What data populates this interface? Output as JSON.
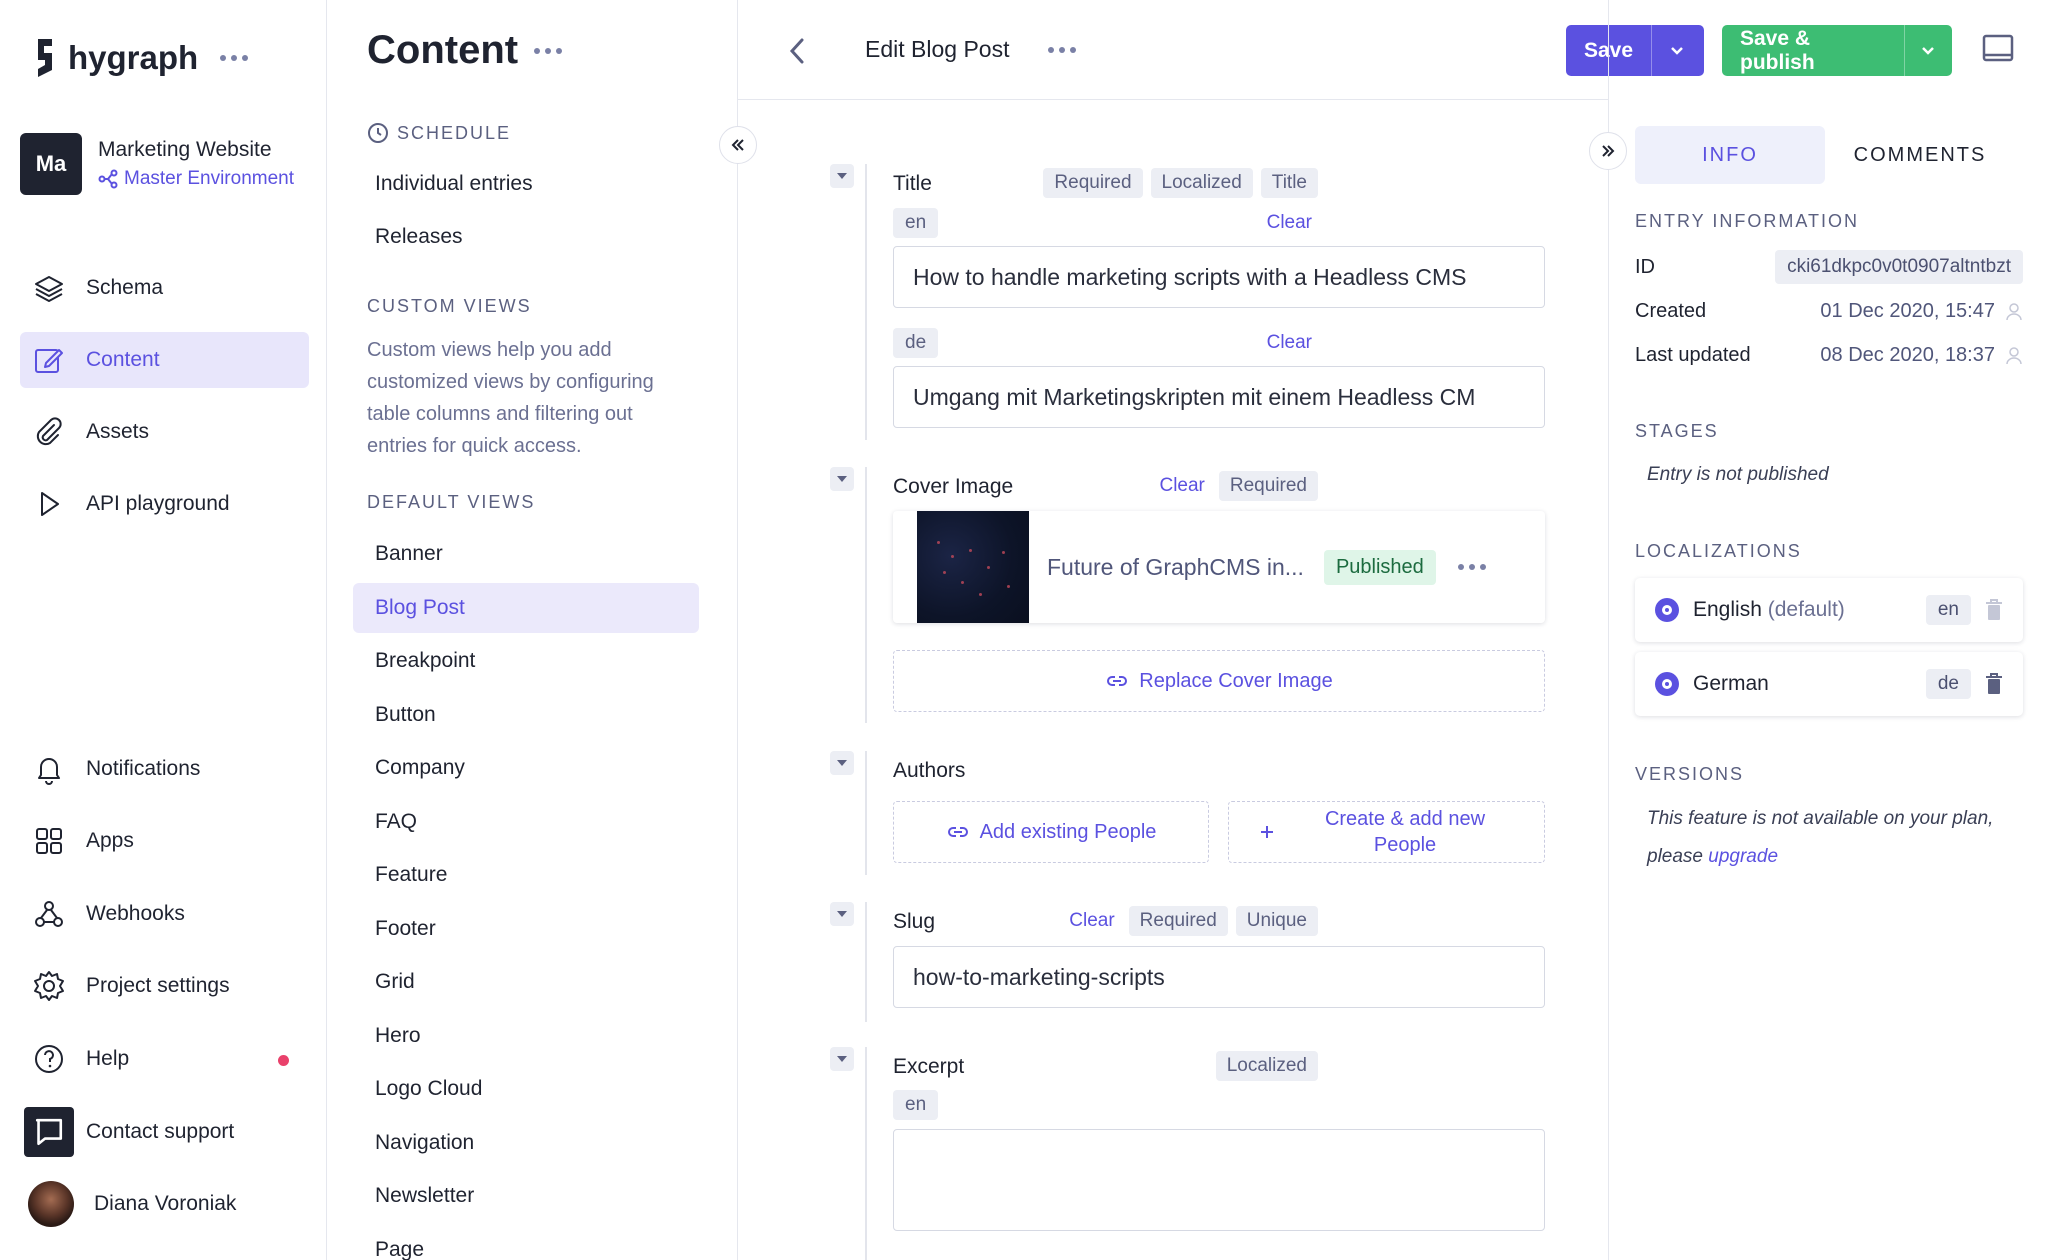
{
  "brand": {
    "name": "hygraph"
  },
  "project": {
    "initials": "Ma",
    "name": "Marketing Website",
    "environment": "Master Environment"
  },
  "nav": {
    "top": [
      {
        "label": "Schema",
        "icon": "layers-icon"
      },
      {
        "label": "Content",
        "icon": "edit-icon",
        "active": true
      },
      {
        "label": "Assets",
        "icon": "paperclip-icon"
      },
      {
        "label": "API playground",
        "icon": "play-icon"
      }
    ],
    "bottom": [
      {
        "label": "Notifications",
        "icon": "bell-icon"
      },
      {
        "label": "Apps",
        "icon": "apps-icon"
      },
      {
        "label": "Webhooks",
        "icon": "webhook-icon"
      },
      {
        "label": "Project settings",
        "icon": "gear-icon"
      },
      {
        "label": "Help",
        "icon": "help-icon"
      },
      {
        "label": "Contact support",
        "icon": "chat-icon"
      }
    ],
    "user": "Diana Voroniak"
  },
  "views": {
    "title": "Content",
    "schedule_heading": "SCHEDULE",
    "schedule_items": [
      "Individual entries",
      "Releases"
    ],
    "custom_heading": "CUSTOM VIEWS",
    "custom_desc": "Custom views help you add customized views by configuring table columns and filtering out entries for quick access.",
    "default_heading": "DEFAULT VIEWS",
    "default_items": [
      "Banner",
      "Blog Post",
      "Breakpoint",
      "Button",
      "Company",
      "FAQ",
      "Feature",
      "Footer",
      "Grid",
      "Hero",
      "Logo Cloud",
      "Navigation",
      "Newsletter",
      "Page"
    ],
    "active_item": "Blog Post"
  },
  "editor": {
    "title": "Edit Blog Post",
    "save_label": "Save",
    "save_publish_label": "Save & publish",
    "fields": {
      "title": {
        "label": "Title",
        "tags": [
          "Required",
          "Localized",
          "Title"
        ],
        "locales": [
          {
            "code": "en",
            "clear": "Clear",
            "value": "How to handle marketing scripts with a Headless CMS"
          },
          {
            "code": "de",
            "clear": "Clear",
            "value": "Umgang mit Marketingskripten mit einem Headless CM"
          }
        ]
      },
      "cover": {
        "label": "Cover Image",
        "clear": "Clear",
        "tags": [
          "Required"
        ],
        "asset_name": "Future of GraphCMS in...",
        "status": "Published",
        "replace_label": "Replace Cover Image"
      },
      "authors": {
        "label": "Authors",
        "add_existing": "Add existing People",
        "create_new": "Create & add new People"
      },
      "slug": {
        "label": "Slug",
        "clear": "Clear",
        "tags": [
          "Required",
          "Unique"
        ],
        "value": "how-to-marketing-scripts"
      },
      "excerpt": {
        "label": "Excerpt",
        "tags": [
          "Localized"
        ],
        "locale": "en",
        "value": ""
      }
    }
  },
  "info": {
    "tabs": [
      "INFO",
      "COMMENTS"
    ],
    "entry_heading": "ENTRY INFORMATION",
    "id_label": "ID",
    "id_value": "cki61dkpc0v0t0907altntbzt",
    "created_label": "Created",
    "created_value": "01 Dec 2020, 15:47",
    "updated_label": "Last updated",
    "updated_value": "08 Dec 2020, 18:37",
    "stages_heading": "STAGES",
    "stages_text": "Entry is not published",
    "localizations_heading": "LOCALIZATIONS",
    "localizations": [
      {
        "name": "English",
        "suffix": "(default)",
        "code": "en"
      },
      {
        "name": "German",
        "suffix": "",
        "code": "de"
      }
    ],
    "versions_heading": "VERSIONS",
    "versions_text": "This feature is not available on your plan,",
    "versions_text2": "please",
    "versions_link": "upgrade"
  },
  "colors": {
    "accent": "#5b51e0",
    "success": "#3dbd73",
    "dark": "#1f2330"
  }
}
